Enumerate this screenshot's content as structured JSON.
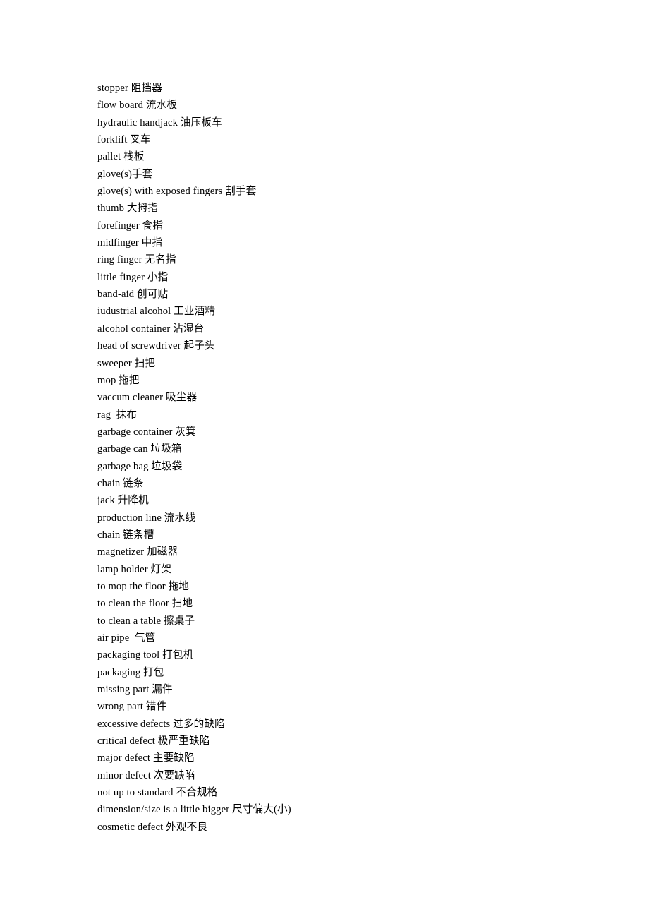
{
  "document": {
    "kind": "bilingual-glossary",
    "language_pair": "English-Chinese",
    "page_background": "#ffffff",
    "text_color": "#000000",
    "line_count": 43
  },
  "glossary": {
    "entries": [
      {
        "term": "stopper",
        "translation": "阻挡器",
        "text": "stopper 阻挡器"
      },
      {
        "term": "flow board",
        "translation": "流水板",
        "text": "flow board 流水板"
      },
      {
        "term": "hydraulic handjack",
        "translation": "油压板车",
        "text": "hydraulic handjack 油压板车"
      },
      {
        "term": "forklift",
        "translation": "叉车",
        "text": "forklift 叉车"
      },
      {
        "term": "pallet",
        "translation": "栈板",
        "text": "pallet 栈板"
      },
      {
        "term": "glove(s)",
        "translation": "手套",
        "text": "glove(s)手套"
      },
      {
        "term": "glove(s) with exposed fingers",
        "translation": "割手套",
        "text": "glove(s) with exposed fingers 割手套"
      },
      {
        "term": "thumb",
        "translation": "大拇指",
        "text": "thumb 大拇指"
      },
      {
        "term": "forefinger",
        "translation": "食指",
        "text": "forefinger 食指"
      },
      {
        "term": "midfinger",
        "translation": "中指",
        "text": "midfinger 中指"
      },
      {
        "term": "ring finger",
        "translation": "无名指",
        "text": "ring finger 无名指"
      },
      {
        "term": "little finger",
        "translation": "小指",
        "text": "little finger 小指"
      },
      {
        "term": "band-aid",
        "translation": "创可贴",
        "text": "band-aid 创可贴"
      },
      {
        "term": "iudustrial alcohol",
        "translation": "工业酒精",
        "text": "iudustrial alcohol 工业酒精"
      },
      {
        "term": "alcohol container",
        "translation": "沾湿台",
        "text": "alcohol container 沾湿台"
      },
      {
        "term": "head of screwdriver",
        "translation": "起子头",
        "text": "head of screwdriver 起子头"
      },
      {
        "term": "sweeper",
        "translation": "扫把",
        "text": "sweeper 扫把"
      },
      {
        "term": "mop",
        "translation": "拖把",
        "text": "mop 拖把"
      },
      {
        "term": "vaccum cleaner",
        "translation": "吸尘器",
        "text": "vaccum cleaner 吸尘器"
      },
      {
        "term": "rag",
        "translation": "抹布",
        "text": "rag  抹布"
      },
      {
        "term": "garbage container",
        "translation": "灰箕",
        "text": "garbage container 灰箕"
      },
      {
        "term": "garbage can",
        "translation": "垃圾箱",
        "text": "garbage can 垃圾箱"
      },
      {
        "term": "garbage bag",
        "translation": "垃圾袋",
        "text": "garbage bag 垃圾袋"
      },
      {
        "term": "chain",
        "translation": "链条",
        "text": "chain 链条"
      },
      {
        "term": "jack",
        "translation": "升降机",
        "text": "jack 升降机"
      },
      {
        "term": "production line",
        "translation": "流水线",
        "text": "production line 流水线"
      },
      {
        "term": "chain",
        "translation": "链条槽",
        "text": "chain 链条槽"
      },
      {
        "term": "magnetizer",
        "translation": "加磁器",
        "text": "magnetizer 加磁器"
      },
      {
        "term": "lamp holder",
        "translation": "灯架",
        "text": "lamp holder 灯架"
      },
      {
        "term": "to mop the floor",
        "translation": "拖地",
        "text": "to mop the floor 拖地"
      },
      {
        "term": "to clean the floor",
        "translation": "扫地",
        "text": "to clean the floor 扫地"
      },
      {
        "term": "to clean a table",
        "translation": "擦桌子",
        "text": "to clean a table 擦桌子"
      },
      {
        "term": "air pipe",
        "translation": "气管",
        "text": "air pipe  气管"
      },
      {
        "term": "packaging tool",
        "translation": "打包机",
        "text": "packaging tool 打包机"
      },
      {
        "term": "packaging",
        "translation": "打包",
        "text": "packaging 打包"
      },
      {
        "term": "missing part",
        "translation": "漏件",
        "text": "missing part 漏件"
      },
      {
        "term": "wrong part",
        "translation": "错件",
        "text": "wrong part 错件"
      },
      {
        "term": "excessive defects",
        "translation": "过多的缺陷",
        "text": "excessive defects 过多的缺陷"
      },
      {
        "term": "critical defect",
        "translation": "极严重缺陷",
        "text": "critical defect 极严重缺陷"
      },
      {
        "term": "major defect",
        "translation": "主要缺陷",
        "text": "major defect 主要缺陷"
      },
      {
        "term": "minor defect",
        "translation": "次要缺陷",
        "text": "minor defect 次要缺陷"
      },
      {
        "term": "not up to standard",
        "translation": "不合规格",
        "text": "not up to standard 不合规格"
      },
      {
        "term": "dimension/size is a little bigger",
        "translation": "尺寸偏大(小)",
        "text": "dimension/size is a little bigger 尺寸偏大(小)"
      },
      {
        "term": "cosmetic defect",
        "translation": "外观不良",
        "text": "cosmetic defect 外观不良"
      }
    ]
  }
}
